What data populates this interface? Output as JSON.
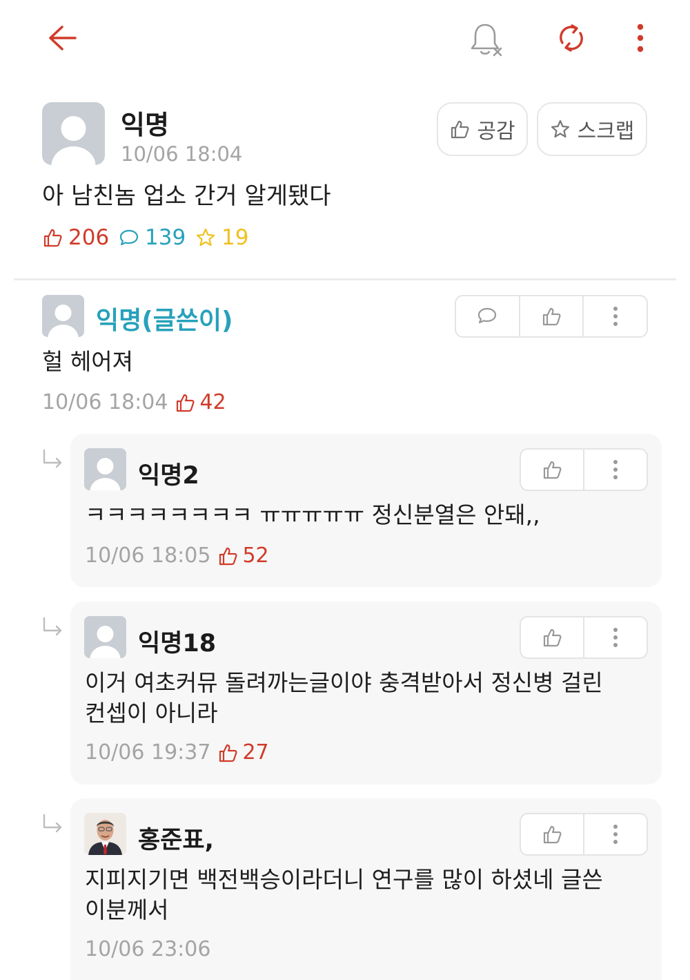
{
  "colors": {
    "accent": "#d03b2a",
    "comment_blue": "#27a1bb",
    "star_yellow": "#f0c020",
    "muted": "#a4a4a4"
  },
  "topbar": {
    "icons": [
      "back-arrow-icon",
      "bell-off-icon",
      "refresh-icon",
      "more-vertical-icon"
    ]
  },
  "post": {
    "author": "익명",
    "time": "10/06 18:04",
    "body": "아 남친놈 업소 간거 알게됐다",
    "like_button": "공감",
    "scrap_button": "스크랩",
    "likes": "206",
    "comments": "139",
    "scraps": "19"
  },
  "comments": [
    {
      "author": "익명(글쓴이)",
      "body": "헐 헤어져",
      "time": "10/06 18:04",
      "likes": "42"
    }
  ],
  "replies": [
    {
      "author": "익명2",
      "body": "ㅋㅋㅋㅋㅋㅋㅋㅋ ㅠㅠㅠㅠㅠ 정신분열은 안돼,,",
      "time": "10/06 18:05",
      "likes": "52"
    },
    {
      "author": "익명18",
      "body_line1": "이거 여초커뮤 돌려까는글이야 충격받아서 정신병 걸린",
      "body_line2": "컨셉이 아니라",
      "time": "10/06 19:37",
      "likes": "27"
    },
    {
      "author": "홍준표,",
      "body_line1": "지피지기면 백전백승이라더니 연구를 많이 하셨네 글쓴",
      "body_line2": "이분께서",
      "time": "10/06 23:06"
    }
  ]
}
